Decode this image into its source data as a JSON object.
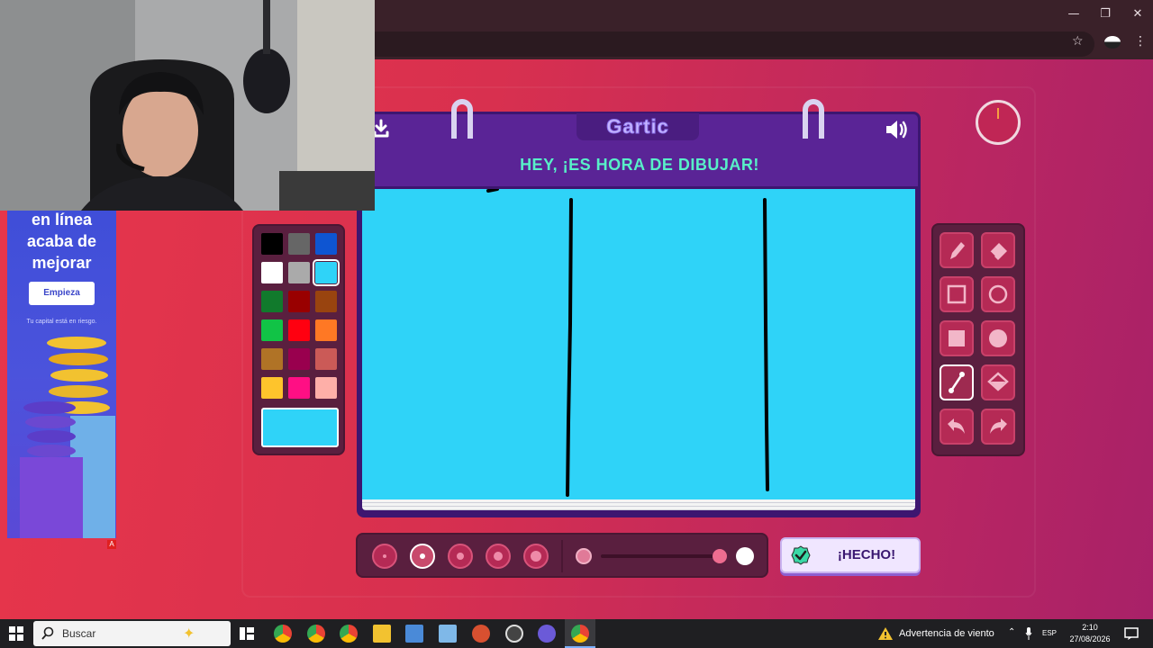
{
  "browser": {
    "window_controls": {
      "minimize": "—",
      "restore": "❐",
      "close": "✕"
    },
    "toolbar_icons": {
      "bookmark": "☆",
      "menu": "⋮"
    }
  },
  "ad": {
    "headline": [
      "en línea",
      "acaba de",
      "mejorar"
    ],
    "cta": "Empieza",
    "disclaimer": "Tu capital está en riesgo.",
    "badge": "A"
  },
  "game": {
    "logo": "Gartic",
    "title": "HEY, ¡ES HORA DE DIBUJAR!",
    "done_button": "¡HECHO!",
    "palette": {
      "colors": [
        "#000000",
        "#666666",
        "#0e55d2",
        "#ffffff",
        "#aaaaaa",
        "#2fd3f8",
        "#117a2c",
        "#990000",
        "#99440f",
        "#11c346",
        "#ff0010",
        "#ff7824",
        "#b07326",
        "#99004e",
        "#cb5a57",
        "#fec42c",
        "#ff0f84",
        "#feafa8"
      ],
      "selected_index": 5,
      "current_color": "#2fd3f8"
    },
    "tools": [
      "pencil",
      "eraser",
      "rect-outline",
      "circle-outline",
      "rect-filled",
      "circle-filled",
      "line",
      "fill-bucket",
      "undo",
      "redo"
    ],
    "selected_tool": "line",
    "brush_sizes": [
      1,
      2,
      3,
      4,
      5
    ],
    "selected_brush_size": 2
  },
  "taskbar": {
    "search_placeholder": "Buscar",
    "weather": "Advertencia de viento",
    "language": "ESP",
    "time": "2:10",
    "date": "27/08/2026"
  }
}
